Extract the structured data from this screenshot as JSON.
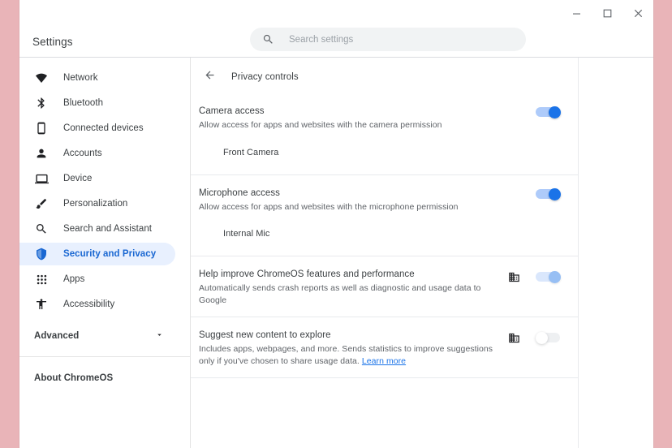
{
  "window": {
    "controls": {
      "minimize": "minimize",
      "maximize": "maximize",
      "close": "close"
    }
  },
  "header": {
    "title": "Settings",
    "search": {
      "placeholder": "Search settings",
      "value": ""
    }
  },
  "sidebar": {
    "items": [
      {
        "label": "Network",
        "icon": "wifi-icon",
        "active": false
      },
      {
        "label": "Bluetooth",
        "icon": "bluetooth-icon",
        "active": false
      },
      {
        "label": "Connected devices",
        "icon": "phone-icon",
        "active": false
      },
      {
        "label": "Accounts",
        "icon": "person-icon",
        "active": false
      },
      {
        "label": "Device",
        "icon": "laptop-icon",
        "active": false
      },
      {
        "label": "Personalization",
        "icon": "brush-icon",
        "active": false
      },
      {
        "label": "Search and Assistant",
        "icon": "search-icon",
        "active": false
      },
      {
        "label": "Security and Privacy",
        "icon": "shield-icon",
        "active": true
      },
      {
        "label": "Apps",
        "icon": "grid-apps-icon",
        "active": false
      },
      {
        "label": "Accessibility",
        "icon": "accessibility-icon",
        "active": false
      }
    ],
    "advanced": {
      "label": "Advanced",
      "icon": "chevron-down-icon"
    },
    "about": {
      "label": "About ChromeOS"
    }
  },
  "main": {
    "back": "back-arrow-icon",
    "title": "Privacy controls",
    "sections": [
      {
        "id": "camera",
        "title": "Camera access",
        "subtitle": "Allow access for apps and websites with the camera permission",
        "toggle": {
          "state": "on",
          "managed": false
        },
        "device": "Front Camera"
      },
      {
        "id": "microphone",
        "title": "Microphone access",
        "subtitle": "Allow access for apps and websites with the microphone permission",
        "toggle": {
          "state": "on",
          "managed": false
        },
        "device": "Internal Mic"
      },
      {
        "id": "metrics",
        "title": "Help improve ChromeOS features and performance",
        "subtitle": "Automatically sends crash reports as well as diagnostic and usage data to Google",
        "toggle": {
          "state": "on",
          "managed": true
        },
        "managed_icon": "enterprise-building-icon"
      },
      {
        "id": "content-suggestions",
        "title": "Suggest new content to explore",
        "subtitle_part1": "Includes apps, webpages, and more. Sends statistics to improve suggestions only if you've chosen to share usage data. ",
        "subtitle_link": "Learn more",
        "toggle": {
          "state": "off",
          "managed": true
        },
        "managed_icon": "enterprise-building-icon"
      }
    ]
  },
  "colors": {
    "desktop_background": "#e9b4b8",
    "accent_blue": "#1a73e8",
    "active_nav_bg": "#e8f0fe",
    "active_nav_text": "#1967d2",
    "link": "#1a73e8",
    "primary_text": "#3c4043",
    "secondary_text": "#5f6368",
    "toggle_track_on": "#aecbfa",
    "toggle_track_off": "#e8eaed"
  }
}
